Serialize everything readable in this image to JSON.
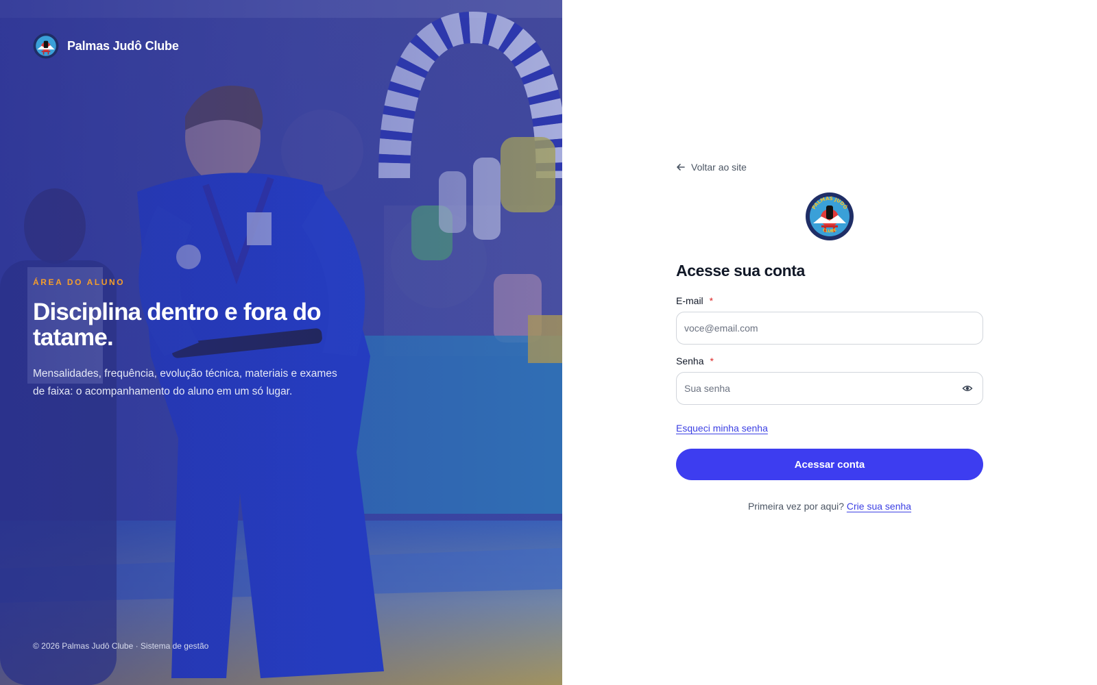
{
  "hero": {
    "brand_name": "Palmas Judô Clube",
    "eyebrow": "ÁREA DO ALUNO",
    "title": "Disciplina dentro e fora do tatame.",
    "description": "Mensalidades, frequência, evolução técnica, materiais e exames de faixa: o acompanhamento do aluno em um só lugar.",
    "footer": "© 2026 Palmas Judô Clube · Sistema de gestão",
    "logo_text_top": "PALMAS JUDÔ",
    "logo_text_bottom": "CLUBE"
  },
  "login": {
    "back_label": "Voltar ao site",
    "title": "Acesse sua conta",
    "email": {
      "label": "E-mail",
      "required_mark": "*",
      "placeholder": "voce@email.com",
      "value": ""
    },
    "password": {
      "label": "Senha",
      "required_mark": "*",
      "placeholder": "Sua senha",
      "value": ""
    },
    "forgot_label": "Esqueci minha senha",
    "submit_label": "Acessar conta",
    "signup_prompt": "Primeira vez por aqui?",
    "signup_link": "Crie sua senha"
  },
  "colors": {
    "primary": "#3d3df0",
    "link": "#3b3fe3",
    "eyebrow": "#f59e2b",
    "required": "#dc2626",
    "hero_overlay": "#2f3aa0"
  },
  "icons": {
    "back": "arrow-left-icon",
    "password_toggle": "eye-icon",
    "logo": "club-logo"
  }
}
